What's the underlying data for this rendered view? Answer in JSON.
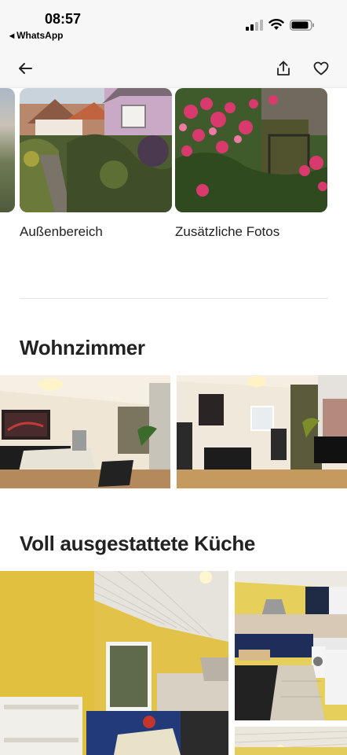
{
  "status_bar": {
    "time": "08:57",
    "back_app": "WhatsApp",
    "back_glyph": "◀"
  },
  "nav": {
    "back_icon": "arrow-left-icon",
    "share_icon": "share-icon",
    "save_icon": "heart-icon"
  },
  "sections": {
    "outdoor": {
      "label": "Außenbereich"
    },
    "extra": {
      "label": "Zusätzliche Fotos"
    },
    "living": {
      "title": "Wohnzimmer"
    },
    "kitchen": {
      "title": "Voll ausgestattete Küche"
    }
  },
  "colors": {
    "text": "#222222",
    "background": "#ffffff",
    "divider": "#e4e4e4",
    "status_bar": "#f7f7f7"
  }
}
